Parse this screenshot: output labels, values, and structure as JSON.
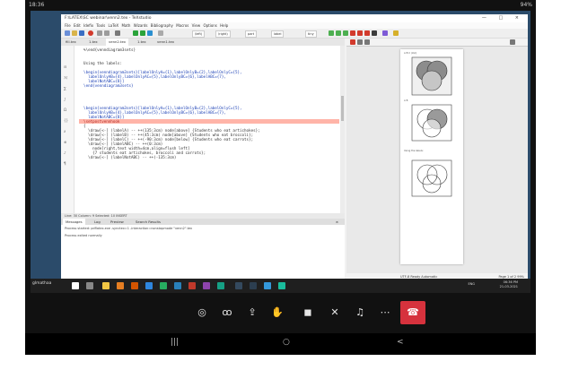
{
  "phone_status": {
    "time": "18:36",
    "battery": "94%"
  },
  "window": {
    "title": "F:\\LATEX\\SC webinar\\venn2.tex - TeXstudio",
    "menu": [
      "File",
      "Edit",
      "Idefix",
      "Tools",
      "LaTeX",
      "Math",
      "Wizards",
      "Bibliography",
      "Macros",
      "View",
      "Options",
      "Help"
    ],
    "controls": "— □ ×"
  },
  "toolbar": {
    "sel1": "\\left(",
    "sel2": "\\right)",
    "sel3": "part",
    "sel4": "label",
    "sel5": "tiny"
  },
  "tabs": [
    "fill.tex",
    "1.tex",
    "venn2.tex",
    "1.tex",
    "venn1.tex"
  ],
  "editor": {
    "lines": [
      "  %\\end{venndiagram3sets}",
      "",
      "",
      "  Using the labels:",
      "",
      "  \\begin{venndiagram3sets}[labelOnlyA={1},labelOnlyB={2},labelOnlyC={5},",
      "    labelOnlyAB={4},labelOnlyAC={5},labelOnlyBC={6},labelABC={7},",
      "    labelNotABC={8}]",
      "  \\end{venndiagram3sets}",
      "",
      "",
      "",
      "",
      "  \\begin{venndiagram3sets}[labelOnlyA={1},labelOnlyB={2},labelOnlyC={5},",
      "    labelOnlyAB={4},labelOnlyAC={5},labelOnlyBC={6},labelABC={7},",
      "    labelNotABC={8}]",
      "  \\setpostvennhook",
      "  {",
      "    \\draw[<-] (labelA) -- ++(135:3cm) node[above] {Students who eat artichokes};",
      "    \\draw[<-] (labelB) -- ++(45:3cm) node[above] {Students who eat broccoli};",
      "    \\draw[<-] (labelC) -- ++(-90:3cm) node[below] {Students who eat carrots};",
      "    \\draw[<-] (labelABC) -- ++(0:3cm)",
      "      node[right,text width=4cm,align=flush left]",
      "      {7 students eat artichokes, broccoli and carrots};",
      "    \\draw[<-] (labelNotABC) -- ++(-135:3cm)"
    ],
    "gutter_marks": [
      "⊟",
      "ℳ",
      "∑",
      "∫",
      "Ω",
      "{}",
      "∂",
      "⊕",
      "♪",
      "¶"
    ],
    "status": "Line: 30   Column: 9   Selected: 10        INSERT"
  },
  "messages": {
    "tabs": [
      "Messages",
      "Log",
      "Preview",
      "Search Results"
    ],
    "close": "×",
    "lines": [
      "Process started: pdflatex.exe -synctex=1 -interaction=nonstopmode \"venn2\".tex",
      "",
      "Process exited normally"
    ]
  },
  "pdf": {
    "labels": [
      "A  B  C  (A\\C)",
      "A  B",
      "Using the labels:"
    ],
    "status": "Page 1 of 2   99%",
    "encoding": "UTF-8   Ready   Automatic"
  },
  "taskbar": {
    "user": "glmathaa",
    "time": "06:36 PM",
    "date": "21-03-2021",
    "lang": "ENG"
  },
  "call": {
    "icons": [
      "chat-icon",
      "people-icon",
      "share-icon",
      "hand-icon",
      "camera-off-icon",
      "mic-off-icon",
      "audio-icon",
      "more-icon",
      "end-call-icon"
    ]
  },
  "nav": {
    "recents": "|||",
    "home": "○",
    "back": "<"
  }
}
